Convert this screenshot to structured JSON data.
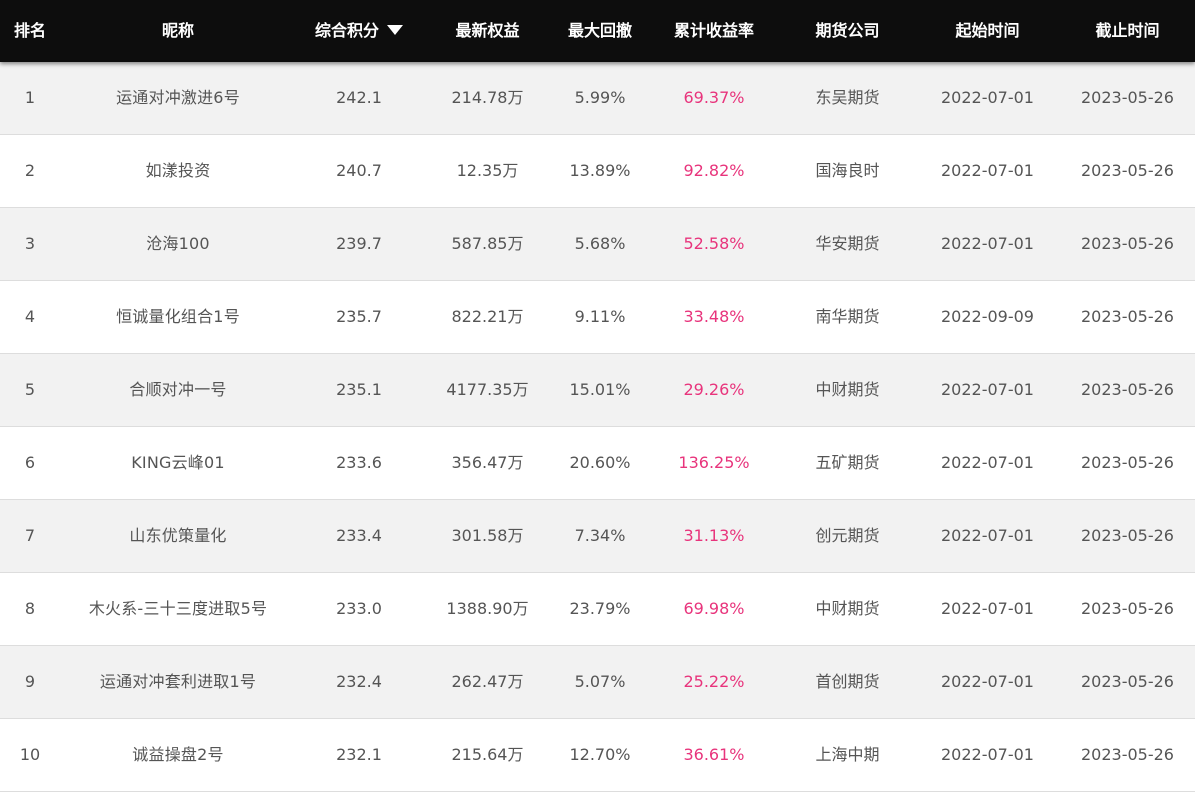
{
  "header": {
    "rank": "排名",
    "nickname": "昵称",
    "score": "综合积分",
    "equity": "最新权益",
    "max_drawdown": "最大回撤",
    "cum_return": "累计收益率",
    "broker": "期货公司",
    "start_date": "起始时间",
    "end_date": "截止时间",
    "sort_icon": "triangle-down-icon"
  },
  "colors": {
    "header_bg": "#0d0d0d",
    "header_text": "#ffffff",
    "row_odd_bg": "#f2f2f2",
    "row_even_bg": "#ffffff",
    "text": "#555555",
    "return_text": "#e8347c"
  },
  "rows": [
    {
      "rank": "1",
      "nickname": "运通对冲激进6号",
      "score": "242.1",
      "equity": "214.78万",
      "max_drawdown": "5.99%",
      "cum_return": "69.37%",
      "broker": "东吴期货",
      "start_date": "2022-07-01",
      "end_date": "2023-05-26"
    },
    {
      "rank": "2",
      "nickname": "如漾投资",
      "score": "240.7",
      "equity": "12.35万",
      "max_drawdown": "13.89%",
      "cum_return": "92.82%",
      "broker": "国海良时",
      "start_date": "2022-07-01",
      "end_date": "2023-05-26"
    },
    {
      "rank": "3",
      "nickname": "沧海100",
      "score": "239.7",
      "equity": "587.85万",
      "max_drawdown": "5.68%",
      "cum_return": "52.58%",
      "broker": "华安期货",
      "start_date": "2022-07-01",
      "end_date": "2023-05-26"
    },
    {
      "rank": "4",
      "nickname": "恒诚量化组合1号",
      "score": "235.7",
      "equity": "822.21万",
      "max_drawdown": "9.11%",
      "cum_return": "33.48%",
      "broker": "南华期货",
      "start_date": "2022-09-09",
      "end_date": "2023-05-26"
    },
    {
      "rank": "5",
      "nickname": "合顺对冲一号",
      "score": "235.1",
      "equity": "4177.35万",
      "max_drawdown": "15.01%",
      "cum_return": "29.26%",
      "broker": "中财期货",
      "start_date": "2022-07-01",
      "end_date": "2023-05-26"
    },
    {
      "rank": "6",
      "nickname": "KING云峰01",
      "score": "233.6",
      "equity": "356.47万",
      "max_drawdown": "20.60%",
      "cum_return": "136.25%",
      "broker": "五矿期货",
      "start_date": "2022-07-01",
      "end_date": "2023-05-26"
    },
    {
      "rank": "7",
      "nickname": "山东优策量化",
      "score": "233.4",
      "equity": "301.58万",
      "max_drawdown": "7.34%",
      "cum_return": "31.13%",
      "broker": "创元期货",
      "start_date": "2022-07-01",
      "end_date": "2023-05-26"
    },
    {
      "rank": "8",
      "nickname": "木火系-三十三度进取5号",
      "score": "233.0",
      "equity": "1388.90万",
      "max_drawdown": "23.79%",
      "cum_return": "69.98%",
      "broker": "中财期货",
      "start_date": "2022-07-01",
      "end_date": "2023-05-26"
    },
    {
      "rank": "9",
      "nickname": "运通对冲套利进取1号",
      "score": "232.4",
      "equity": "262.47万",
      "max_drawdown": "5.07%",
      "cum_return": "25.22%",
      "broker": "首创期货",
      "start_date": "2022-07-01",
      "end_date": "2023-05-26"
    },
    {
      "rank": "10",
      "nickname": "诚益操盘2号",
      "score": "232.1",
      "equity": "215.64万",
      "max_drawdown": "12.70%",
      "cum_return": "36.61%",
      "broker": "上海中期",
      "start_date": "2022-07-01",
      "end_date": "2023-05-26"
    }
  ]
}
